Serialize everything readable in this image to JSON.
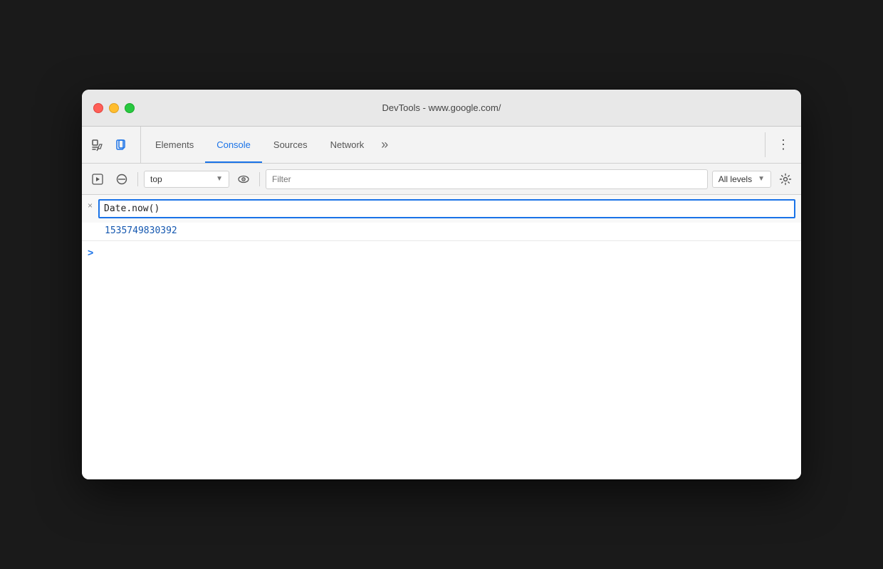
{
  "window": {
    "title": "DevTools - www.google.com/"
  },
  "titlebar": {
    "title": "DevTools - www.google.com/"
  },
  "tabs": {
    "items": [
      {
        "id": "elements",
        "label": "Elements",
        "active": false
      },
      {
        "id": "console",
        "label": "Console",
        "active": true
      },
      {
        "id": "sources",
        "label": "Sources",
        "active": false
      },
      {
        "id": "network",
        "label": "Network",
        "active": false
      }
    ],
    "more_label": "»",
    "kebab_label": "⋮"
  },
  "toolbar": {
    "context_value": "top",
    "filter_placeholder": "Filter",
    "levels_label": "All levels"
  },
  "console": {
    "entry": {
      "input_value": "Date.now()",
      "result_value": "1535749830392"
    },
    "prompt_chevron": ">"
  },
  "icons": {
    "inspect": "⬚",
    "device": "⬜",
    "run": "▶",
    "no_entry": "🚫",
    "chevron_down": "▼",
    "eye": "◎",
    "gear": "⚙",
    "close": "×"
  }
}
